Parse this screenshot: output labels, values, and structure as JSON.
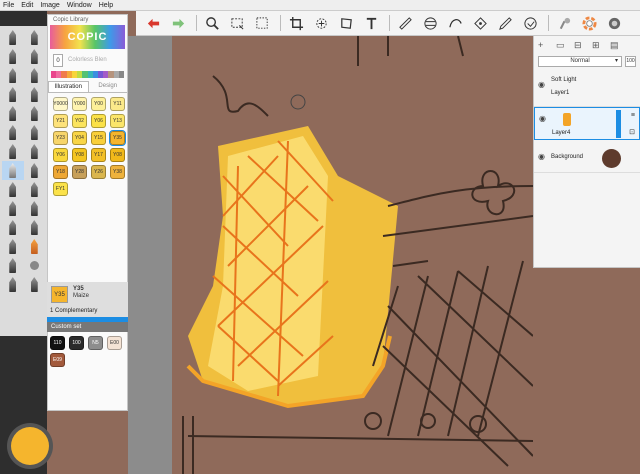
{
  "menu": [
    "File",
    "Edit",
    "Image",
    "Window",
    "Help"
  ],
  "toolbar_icons": [
    "undo-icon",
    "redo-icon",
    "zoom-icon",
    "select-rect-icon",
    "lasso-icon",
    "crop-icon",
    "magic-wand-icon",
    "transform-icon",
    "text-icon",
    "ruler-icon",
    "symmetry-icon",
    "curve-icon",
    "perspective-icon",
    "pen-icon",
    "color-circle-icon",
    "brush-library-icon",
    "puck-icon"
  ],
  "copic": {
    "title": "Copic Library",
    "logo": "COPIC",
    "colorless": {
      "chip": "0",
      "label": "Colorless Blen"
    },
    "tabs": [
      "Illustration",
      "Design"
    ],
    "swatches": [
      {
        "code": "Y0000",
        "color": "#fff8c9"
      },
      {
        "code": "Y000",
        "color": "#fff4b0"
      },
      {
        "code": "Y00",
        "color": "#fdf099"
      },
      {
        "code": "Y11",
        "color": "#fbe98a"
      },
      {
        "code": "Y21",
        "color": "#fde27a"
      },
      {
        "code": "Y02",
        "color": "#fbe45e"
      },
      {
        "code": "Y06",
        "color": "#fbe148"
      },
      {
        "code": "Y13",
        "color": "#fbe56a"
      },
      {
        "code": "Y23",
        "color": "#f7d56a"
      },
      {
        "code": "Y04",
        "color": "#f8d547"
      },
      {
        "code": "Y15",
        "color": "#f9cf3a"
      },
      {
        "code": "Y35",
        "color": "#f5b52d"
      },
      {
        "code": "Y06",
        "color": "#f9d73b"
      },
      {
        "code": "Y08",
        "color": "#f4c51f"
      },
      {
        "code": "Y17",
        "color": "#f3bf26"
      },
      {
        "code": "Y08",
        "color": "#f1b91a"
      },
      {
        "code": "Y18",
        "color": "#eea734"
      },
      {
        "code": "Y28",
        "color": "#c7a05a"
      },
      {
        "code": "Y26",
        "color": "#dab64e"
      },
      {
        "code": "Y38",
        "color": "#eeb23c"
      },
      {
        "code": "FY1",
        "color": "#fbe24a"
      }
    ],
    "selected": {
      "code": "Y35",
      "name": "Maize",
      "complement": "1 Complementary",
      "color": "#f5b52d"
    },
    "custom_set_label": "Custom set",
    "custom_swatches": [
      {
        "code": "110",
        "color": "#111111",
        "text": "#fff"
      },
      {
        "code": "100",
        "color": "#2a2a2a",
        "text": "#fff"
      },
      {
        "code": "N5",
        "color": "#8d8d8d",
        "text": "#fff"
      },
      {
        "code": "E00",
        "color": "#f4e3d5",
        "text": "#333"
      },
      {
        "code": "E09",
        "color": "#a2593b",
        "text": "#fff"
      }
    ]
  },
  "layers": {
    "blend_mode": "Normal",
    "opacity": "100",
    "items": [
      {
        "mode": "Soft Light",
        "name": "Layer1"
      },
      {
        "name": "Layer4"
      },
      {
        "name": "Background"
      }
    ]
  },
  "current_color": "#f5b52d"
}
